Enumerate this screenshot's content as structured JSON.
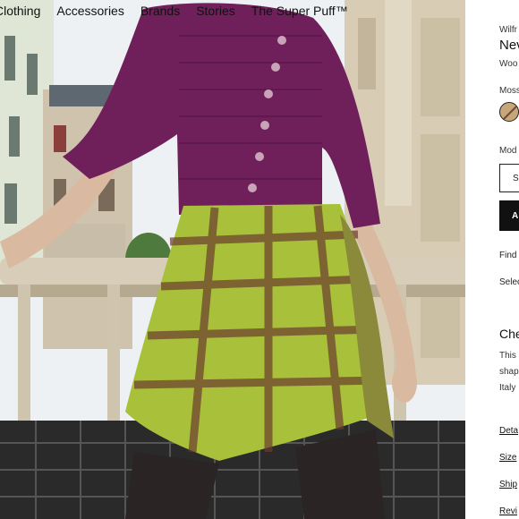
{
  "nav": {
    "items": [
      "Clothing",
      "Accessories",
      "Brands",
      "Stories",
      "The Super Puff™"
    ]
  },
  "product": {
    "brand": "Wilfr",
    "title": "Nev",
    "material": "Woo",
    "color_label": "Moss",
    "swatch_color": "#c9a679",
    "model_label": "Mod",
    "size_select": "Se",
    "add_button": "A",
    "find_link": "Find",
    "select_text": "Selec",
    "check_title": "Che",
    "desc_lines": [
      "This",
      "shap",
      "Italy"
    ],
    "links": [
      "Deta",
      "Size",
      "Ship",
      "Revi"
    ]
  },
  "photo": {
    "colors": {
      "cardigan": "#6f1f5a",
      "skirt_green": "#a9c03a",
      "skirt_brown": "#6b3b30",
      "building": "#d8cdb4",
      "sky": "#eef1f3"
    }
  }
}
